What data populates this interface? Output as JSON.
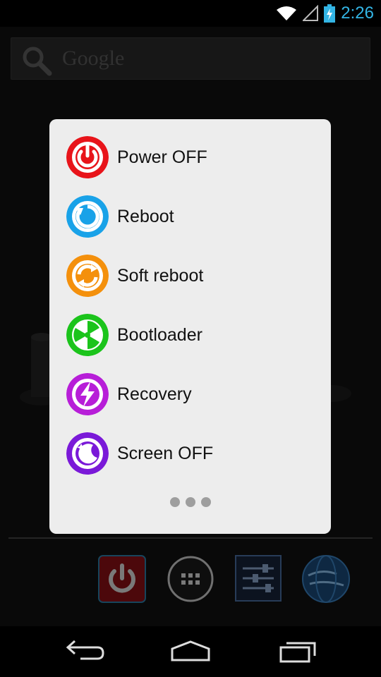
{
  "status_bar": {
    "time": "2:26",
    "icons": [
      "wifi-icon",
      "signal-icon",
      "battery-charging-icon"
    ]
  },
  "search": {
    "placeholder": "Google"
  },
  "menu": {
    "items": [
      {
        "label": "Power OFF",
        "icon": "power-icon",
        "color": "#e8141a"
      },
      {
        "label": "Reboot",
        "icon": "reboot-icon",
        "color": "#19a2e8"
      },
      {
        "label": "Soft reboot",
        "icon": "soft-reboot-icon",
        "color": "#f4900c"
      },
      {
        "label": "Bootloader",
        "icon": "bootloader-icon",
        "color": "#1bc41b"
      },
      {
        "label": "Recovery",
        "icon": "recovery-icon",
        "color": "#b71ed8"
      },
      {
        "label": "Screen OFF",
        "icon": "screen-off-icon",
        "color": "#7a19d8"
      }
    ],
    "more_icon": "more-dots-icon"
  },
  "dock": {
    "items": [
      "power-app-icon",
      "app-drawer-icon",
      "settings-app-icon",
      "globe-app-icon"
    ]
  },
  "nav": {
    "buttons": [
      "back-icon",
      "home-icon",
      "recents-icon"
    ]
  }
}
